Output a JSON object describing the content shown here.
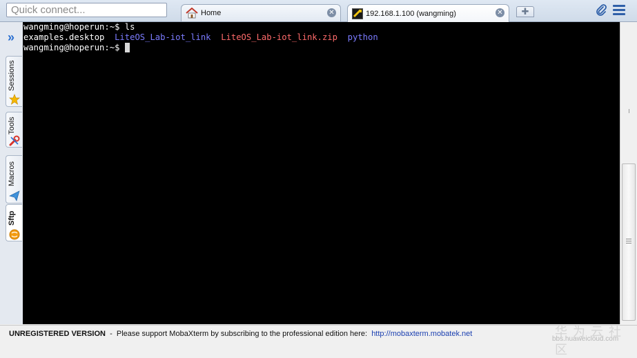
{
  "quick_connect": {
    "placeholder": "Quick connect..."
  },
  "tabs": [
    {
      "label": "Home",
      "icon": "home-icon"
    },
    {
      "label": "192.168.1.100 (wangming)",
      "icon": "ssh-terminal-icon"
    }
  ],
  "sidebar": {
    "items": [
      {
        "label": "Sessions",
        "icon": "star-icon"
      },
      {
        "label": "Tools",
        "icon": "tools-icon"
      },
      {
        "label": "Macros",
        "icon": "paper-plane-icon"
      },
      {
        "label": "Sftp",
        "icon": "sftp-globe-icon"
      }
    ]
  },
  "terminal": {
    "line1": "wangming@hoperun:~$ ls",
    "files": [
      {
        "name": "examples.desktop",
        "kind": "file"
      },
      {
        "name": "LiteOS_Lab-iot_link",
        "kind": "dir"
      },
      {
        "name": "LiteOS_Lab-iot_link.zip",
        "kind": "zip"
      },
      {
        "name": "python",
        "kind": "dir"
      }
    ],
    "prompt": "wangming@hoperun:~$ "
  },
  "colors": {
    "terminal_bg": "#000000",
    "dir": "#7b7bff",
    "zip": "#ff6b6b"
  },
  "status": {
    "unregistered": "UNREGISTERED VERSION",
    "message": "  -  Please support MobaXterm by subscribing to the professional edition here:  ",
    "link": "http://mobaxterm.mobatek.net"
  },
  "watermark": {
    "text": "华为云社区",
    "url": "bbs.huaweicloud.com"
  }
}
